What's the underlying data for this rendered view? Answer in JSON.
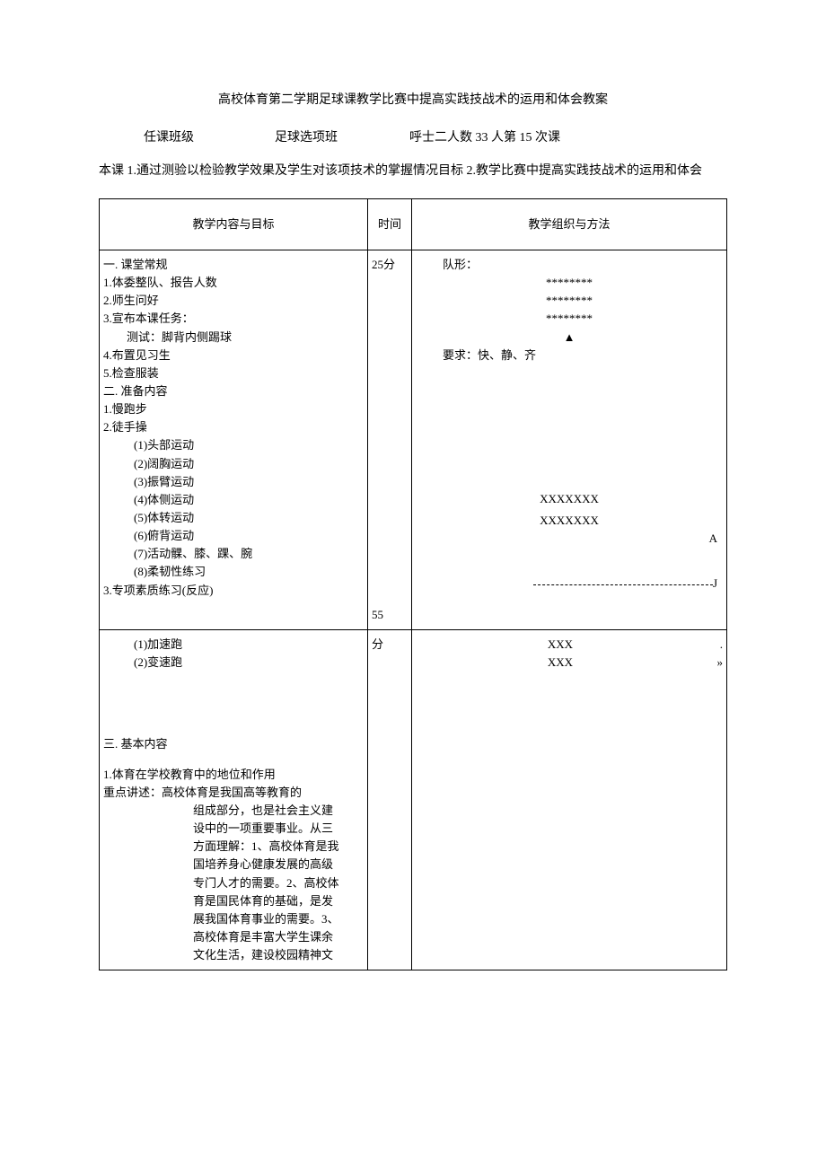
{
  "title": "高校体育第二学期足球课教学比赛中提高实践技战术的运用和体会教案",
  "info": {
    "label_class": "任课班级",
    "class_value": "足球选项班",
    "people_label": "呼士二人数 33 人第 15 次课"
  },
  "goal": "本课 1.通过测验以检验教学效果及学生对该项技术的掌握情况目标 2.教学比赛中提高实践技战术的运用和体会",
  "headers": {
    "col1": "教学内容与目标",
    "col2": "时间",
    "col3": "教学组织与方法"
  },
  "row1": {
    "left": [
      "一. 课堂常规",
      "1.体委整队、报告人数",
      "2.师生问好",
      "3.宣布本课任务：",
      "　　测试：脚背内侧踢球",
      "4.布置见习生",
      "5.检查服装",
      "二. 准备内容",
      "1.慢跑步",
      "2.徒手操"
    ],
    "time": "25分",
    "right_header": "队形：",
    "right_stars": [
      "********",
      "********",
      "********"
    ],
    "right_tri": "▲",
    "right_req": "要求：快、静、齐",
    "exercises": [
      "(1)头部运动",
      "(2)阔胸运动",
      "(3)振臂运动",
      "(4)体侧运动",
      "(5)体转运动",
      "(6)俯背运动",
      "(7)活动髁、膝、踝、腕",
      "(8)柔韧性练习"
    ],
    "right_x_rows": [
      "XXXXXXX",
      "XXXXXXX"
    ],
    "right_tail_letter": "A",
    "line3_left": "3.专项素质练习(反应)",
    "line3_time": "55"
  },
  "row2": {
    "left": [
      "(1)加速跑",
      "(2)变速跑"
    ],
    "time": "分",
    "right": [
      "XXX",
      "XXX"
    ],
    "right_sym1": ".",
    "right_sym2": "»"
  },
  "row3": {
    "header": "三. 基本内容",
    "para_head": "1.体育在学校教育中的地位和作用",
    "para_sub": "重点讲述：高校体育是我国高等教育的",
    "para_body": [
      "组成部分，也是社会主义建",
      "设中的一项重要事业。从三",
      "方面理解：1、高校体育是我",
      "国培养身心健康发展的高级",
      "专门人才的需要。2、高校体",
      "育是国民体育的基础，是发",
      "展我国体育事业的需要。3、",
      "高校体育是丰富大学生课余",
      "文化生活，建设校园精神文"
    ]
  }
}
